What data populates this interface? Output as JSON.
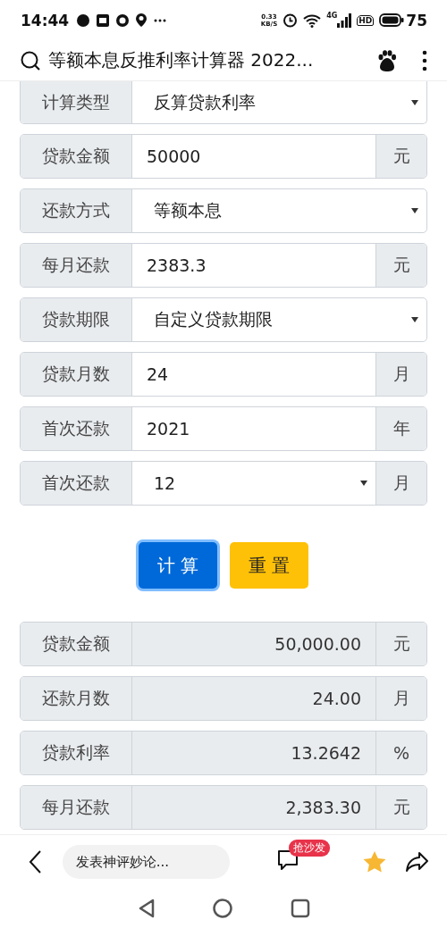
{
  "status_bar": {
    "time": "14:44",
    "net_speed": "0.33",
    "net_unit": "KB/S",
    "network": "4G",
    "hd": "HD",
    "battery": "75"
  },
  "title_bar": {
    "title": "等额本息反推利率计算器 2022..."
  },
  "form": [
    {
      "kind": "select",
      "label": "计算类型",
      "value": "反算贷款利率"
    },
    {
      "kind": "input",
      "label": "贷款金额",
      "value": "50000",
      "unit": "元"
    },
    {
      "kind": "select",
      "label": "还款方式",
      "value": "等额本息"
    },
    {
      "kind": "input",
      "label": "每月还款",
      "value": "2383.3",
      "unit": "元"
    },
    {
      "kind": "select",
      "label": "贷款期限",
      "value": "自定义贷款期限"
    },
    {
      "kind": "input",
      "label": "贷款月数",
      "value": "24",
      "unit": "月"
    },
    {
      "kind": "input",
      "label": "首次还款",
      "value": "2021",
      "unit": "年"
    },
    {
      "kind": "select",
      "label": "首次还款",
      "value": "12",
      "unit": "月"
    }
  ],
  "buttons": [
    {
      "kind": "primary",
      "label": "计 算",
      "focused": true
    },
    {
      "kind": "warning",
      "label": "重 置",
      "focused": false
    }
  ],
  "results": [
    {
      "label": "贷款金额",
      "value": "50,000.00",
      "unit": "元"
    },
    {
      "label": "还款月数",
      "value": "24.00",
      "unit": "月"
    },
    {
      "label": "贷款利率",
      "value": "13.2642",
      "unit": "%"
    },
    {
      "label": "每月还款",
      "value": "2,383.30",
      "unit": "元"
    }
  ],
  "bottom_bar": {
    "comment_placeholder": "发表神评妙论...",
    "badge": "抢沙发"
  }
}
